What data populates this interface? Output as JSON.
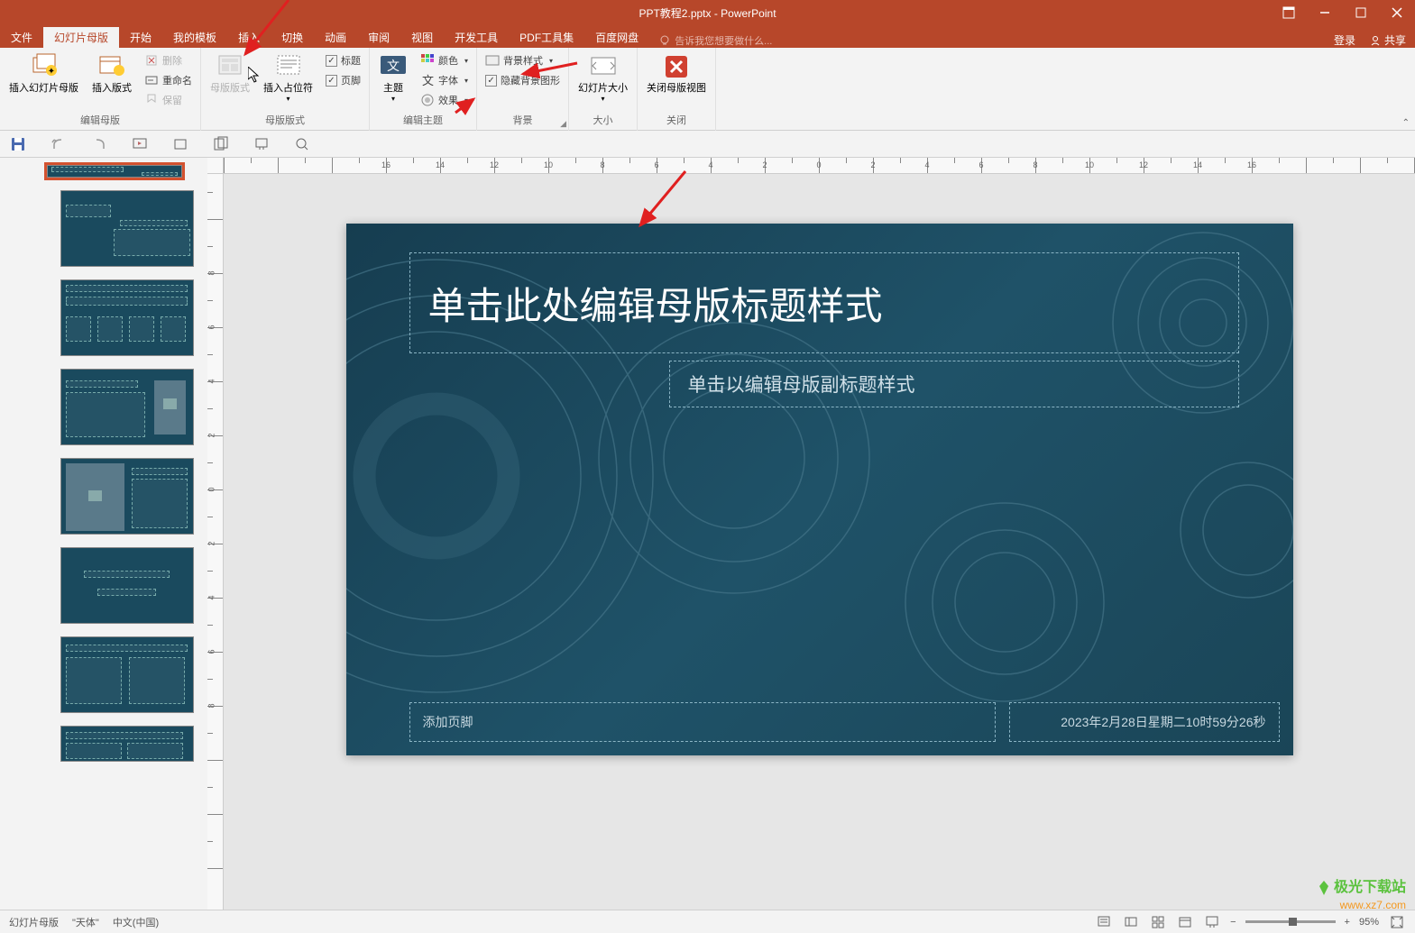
{
  "window": {
    "title": "PPT教程2.pptx - PowerPoint"
  },
  "titlebar_buttons": {
    "login": "登录",
    "share": "共享"
  },
  "tabs": {
    "file": "文件",
    "slide_master": "幻灯片母版",
    "home": "开始",
    "my_templates": "我的模板",
    "insert": "插入",
    "transitions": "切换",
    "animations": "动画",
    "review": "审阅",
    "view": "视图",
    "developer": "开发工具",
    "pdf_tools": "PDF工具集",
    "baidu": "百度网盘",
    "tellme": "告诉我您想要做什么..."
  },
  "ribbon": {
    "edit_master": {
      "insert_slide_master": "插入幻灯片母版",
      "insert_layout": "插入版式",
      "delete": "删除",
      "rename": "重命名",
      "preserve": "保留",
      "label": "编辑母版"
    },
    "master_layout": {
      "master_layout": "母版版式",
      "insert_placeholder": "插入占位符",
      "title_chk": "标题",
      "footer_chk": "页脚",
      "label": "母版版式"
    },
    "edit_theme": {
      "themes": "主题",
      "colors": "颜色",
      "fonts": "字体",
      "effects": "效果",
      "label": "编辑主题"
    },
    "background": {
      "bg_styles": "背景样式",
      "hide_bg_graphics": "隐藏背景图形",
      "label": "背景"
    },
    "size": {
      "slide_size": "幻灯片大小",
      "label": "大小"
    },
    "close": {
      "close_master": "关闭母版视图",
      "label": "关闭"
    }
  },
  "slide": {
    "title_ph": "单击此处编辑母版标题样式",
    "subtitle_ph": "单击以编辑母版副标题样式",
    "footer": "添加页脚",
    "date": "2023年2月28日星期二10时59分26秒"
  },
  "status": {
    "master": "幻灯片母版",
    "theme": "\"天体\"",
    "lang": "中文(中国)",
    "zoom": "95%"
  },
  "ruler_ticks": [
    "16",
    "14",
    "12",
    "10",
    "8",
    "6",
    "4",
    "2",
    "0",
    "2",
    "4",
    "6",
    "8",
    "10",
    "12",
    "14",
    "16"
  ],
  "ruler_ticks_v": [
    "8",
    "6",
    "4",
    "2",
    "0",
    "2",
    "4",
    "6",
    "8"
  ],
  "watermark": {
    "line1": "极光下载站",
    "line2": "www.xz7.com"
  }
}
